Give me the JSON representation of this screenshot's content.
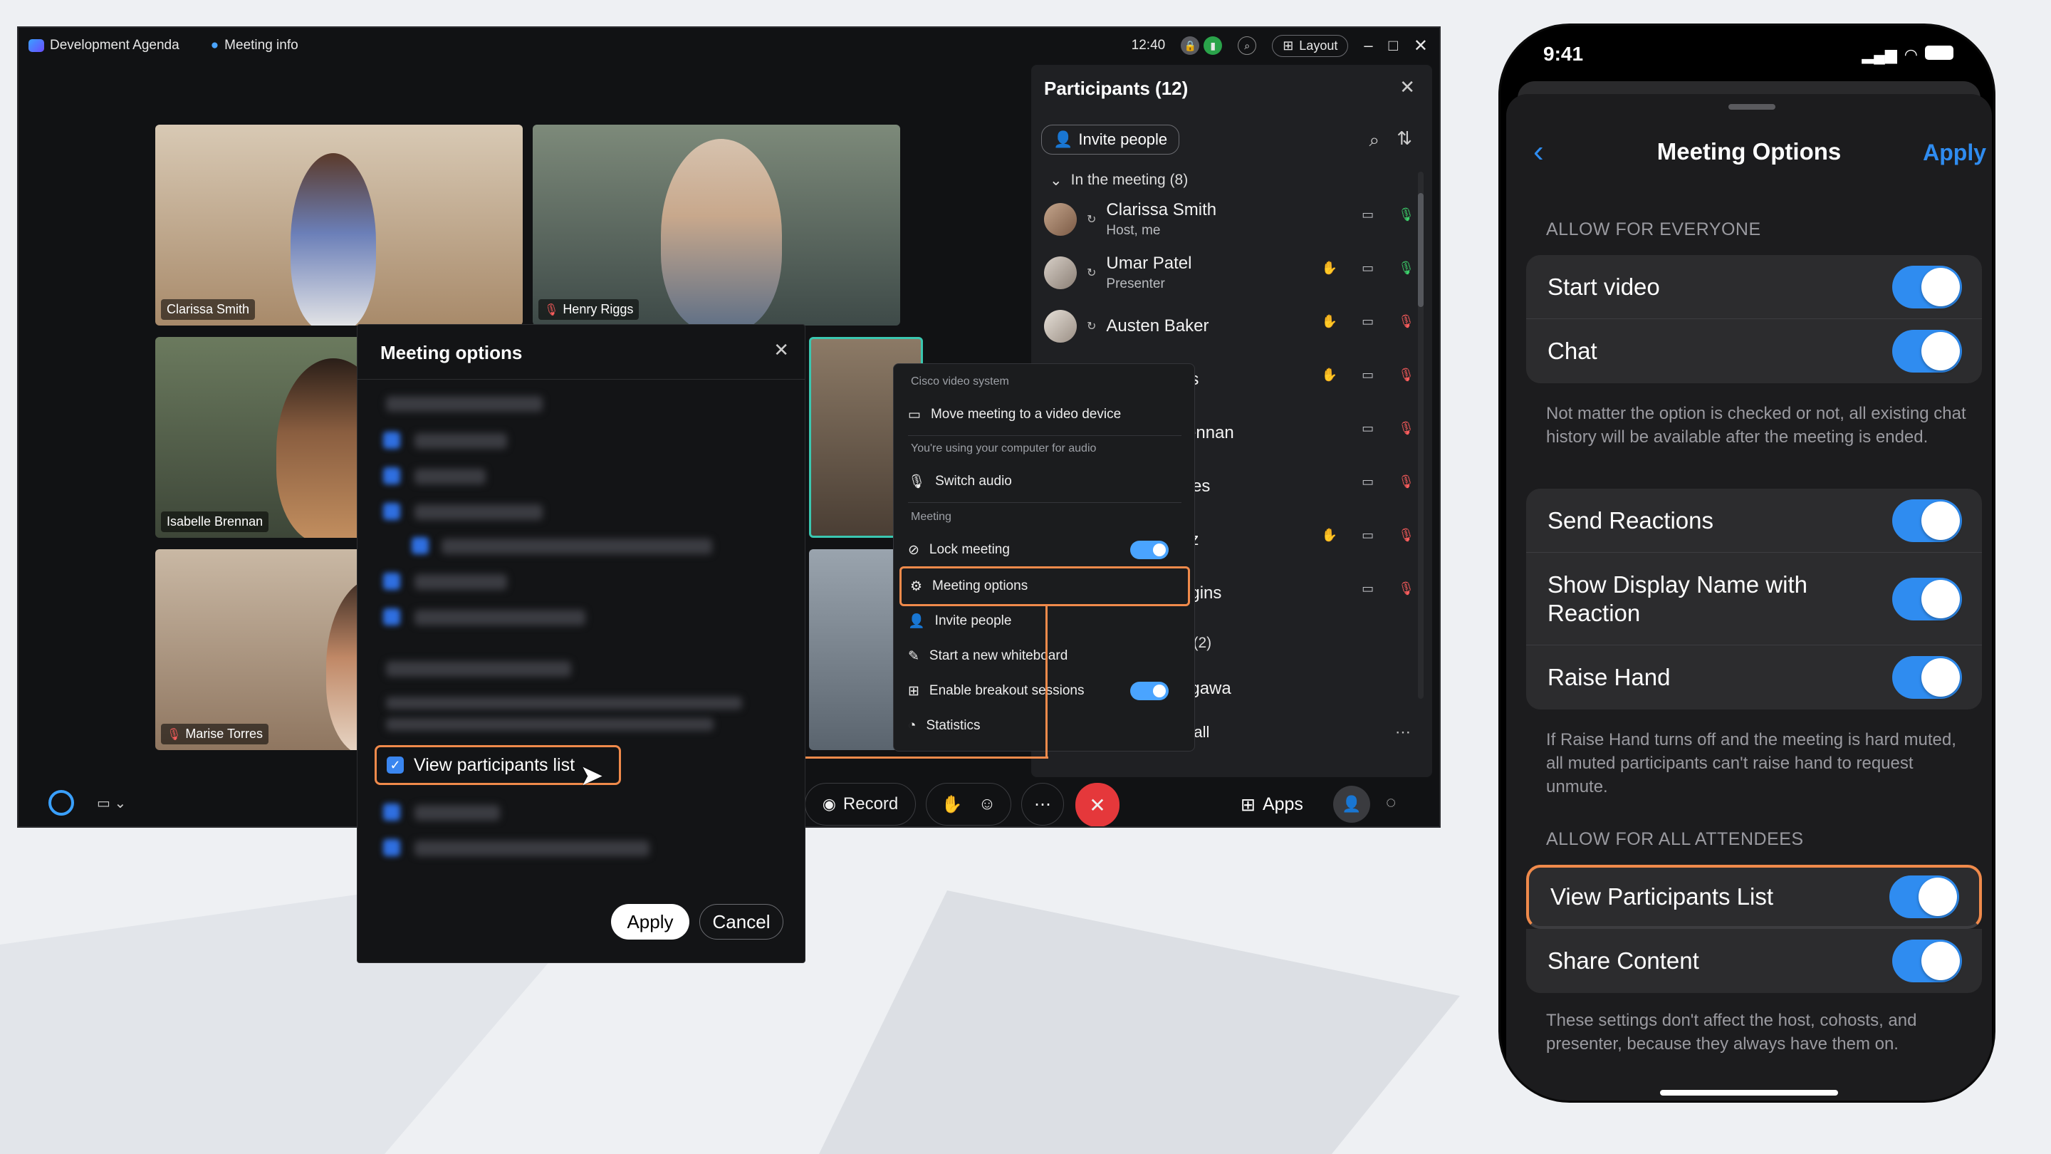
{
  "desktop": {
    "titlebar": {
      "agenda": "Development Agenda",
      "meeting_info": "Meeting info",
      "time": "12:40",
      "layout_label": "Layout"
    },
    "tiles": [
      {
        "name": "Clarissa Smith"
      },
      {
        "name": "Henry Riggs"
      },
      {
        "name": "Isabelle Brennan"
      },
      {
        "name": "Marise Torres"
      }
    ],
    "participants": {
      "title": "Participants (12)",
      "invite_label": "Invite people",
      "in_meeting_label": "In the meeting (8)",
      "rows": [
        {
          "name": "Clarissa Smith",
          "role": "Host, me"
        },
        {
          "name": "Umar Patel",
          "role": "Presenter"
        },
        {
          "name": "Austen Baker",
          "role": ""
        },
        {
          "name": "gs",
          "role": ""
        },
        {
          "name": "rennan",
          "role": ""
        },
        {
          "name": "rres",
          "role": ""
        },
        {
          "name": "ez",
          "role": ""
        },
        {
          "name": "ggins",
          "role": ""
        }
      ],
      "subgroup_label": "g (2)",
      "subgroup_row": "agawa",
      "footer_label": "e all"
    },
    "context_menu": {
      "section1": "Cisco video system",
      "move_meeting": "Move meeting to a video device",
      "section2": "You're using your computer for audio",
      "switch_audio": "Switch audio",
      "section3": "Meeting",
      "lock_meeting": "Lock meeting",
      "meeting_options": "Meeting options",
      "invite_people": "Invite people",
      "whiteboard": "Start a new whiteboard",
      "breakout": "Enable breakout sessions",
      "statistics": "Statistics"
    },
    "modal": {
      "title": "Meeting options",
      "view_participants": "View participants list",
      "view_participants_checked": true,
      "apply": "Apply",
      "cancel": "Cancel"
    },
    "bottombar": {
      "record_label": "Record",
      "apps_label": "Apps"
    }
  },
  "phone": {
    "status_time": "9:41",
    "header": {
      "title": "Meeting Options",
      "apply": "Apply"
    },
    "section_everyone": "ALLOW FOR EVERYONE",
    "group1": [
      {
        "label": "Start video",
        "on": true
      },
      {
        "label": "Chat",
        "on": true
      }
    ],
    "chat_note": "Not matter the option is checked or not, all existing chat history will be available after the meeting is ended.",
    "group2": [
      {
        "label": "Send Reactions",
        "on": true
      },
      {
        "label": "Show Display Name with Reaction",
        "on": true
      },
      {
        "label": "Raise Hand",
        "on": true
      }
    ],
    "raise_note": "If Raise Hand turns off and the meeting is hard muted, all muted participants can't raise hand to request unmute.",
    "section_attendees": "ALLOW FOR ALL ATTENDEES",
    "group3": [
      {
        "label": "View Participants List",
        "on": true
      },
      {
        "label": "Share Content",
        "on": true
      }
    ],
    "footer_note": "These settings don't affect the host, cohosts, and presenter, because they always have them on."
  },
  "colors": {
    "accent_blue": "#4aa4ff",
    "highlight_orange": "#f08a4b",
    "end_call_red": "#e5383b",
    "ios_toggle": "#2f8cf0"
  }
}
